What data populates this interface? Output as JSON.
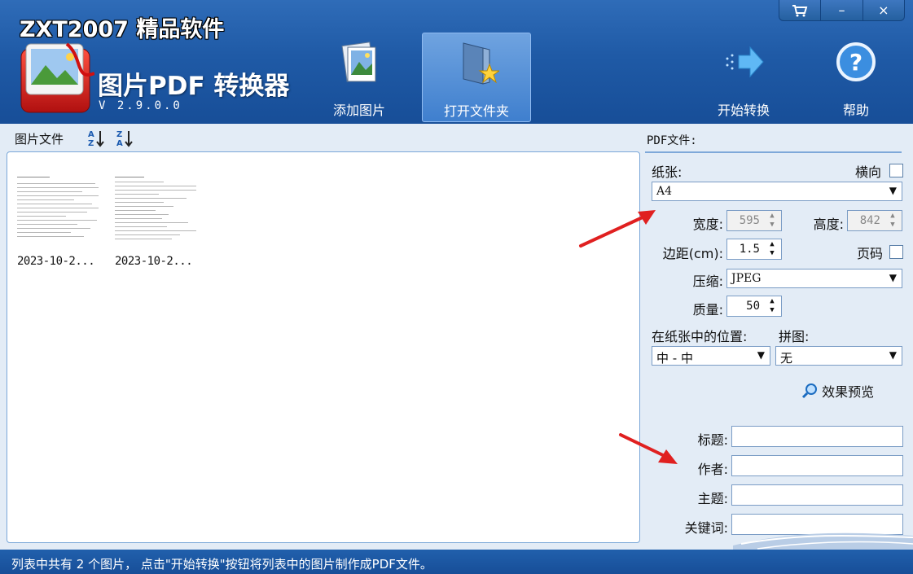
{
  "header": {
    "brand": "ZXT2007 精品软件",
    "app_name": "图片PDF 转换器",
    "version": "V 2.9.0.0",
    "toolbar": {
      "add_images": "添加图片",
      "open_folder": "打开文件夹",
      "start_convert": "开始转换",
      "help": "帮助"
    },
    "window_controls": {
      "cart": "cart-icon",
      "minimize": "–",
      "close": "×"
    }
  },
  "file_panel": {
    "title": "图片文件",
    "sort_asc_icon": "sort-az-icon",
    "sort_desc_icon": "sort-za-icon",
    "files": [
      {
        "name": "2023-10-2..."
      },
      {
        "name": "2023-10-2..."
      }
    ]
  },
  "settings": {
    "section_title": "PDF文件:",
    "paper_label": "纸张:",
    "landscape_label": "横向",
    "paper_value": "A4",
    "width_label": "宽度:",
    "width_value": "595",
    "height_label": "高度:",
    "height_value": "842",
    "margin_label": "边距(cm):",
    "margin_value": "1.5",
    "page_number_label": "页码",
    "compression_label": "压缩:",
    "compression_value": "JPEG",
    "quality_label": "质量:",
    "quality_value": "50",
    "position_label": "在纸张中的位置:",
    "position_value": "中 - 中",
    "tiling_label": "拼图:",
    "tiling_value": "无",
    "preview_label": "效果预览",
    "title_label": "标题:",
    "title_value": "",
    "author_label": "作者:",
    "author_value": "",
    "subject_label": "主题:",
    "subject_value": "",
    "keywords_label": "关键词:",
    "keywords_value": ""
  },
  "status": {
    "text": "列表中共有 2 个图片， 点击\"开始转换\"按钮将列表中的图片制作成PDF文件。"
  },
  "colors": {
    "header_blue": "#1f5aa6",
    "panel_bg": "#e3ecf6",
    "annotation_red": "#e02020"
  }
}
